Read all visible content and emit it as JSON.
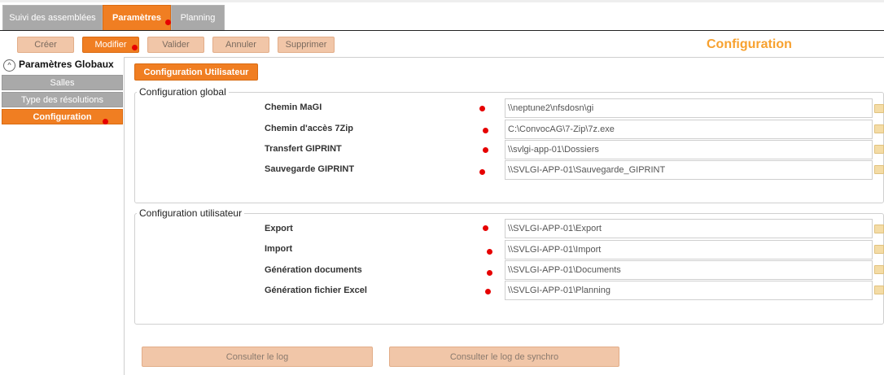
{
  "tabs": [
    {
      "label": "Suivi des assemblées"
    },
    {
      "label": "Paramètres"
    },
    {
      "label": "Planning"
    }
  ],
  "toolbar": {
    "create": "Créer",
    "modify": "Modifier",
    "validate": "Valider",
    "cancel": "Annuler",
    "delete": "Supprimer"
  },
  "page_title": "Configuration",
  "sidebar": {
    "group_label": "Paramètres Globaux",
    "items": [
      {
        "label": "Salles"
      },
      {
        "label": "Type des résolutions"
      },
      {
        "label": "Configuration"
      }
    ]
  },
  "config_user_button": "Configuration Utilisateur",
  "global_section": {
    "legend": "Configuration global",
    "fields": [
      {
        "label": "Chemin MaGI",
        "value": "\\\\neptune2\\nfsdosn\\gi"
      },
      {
        "label": "Chemin d'accès 7Zip",
        "value": "C:\\ConvocAG\\7-Zip\\7z.exe"
      },
      {
        "label": "Transfert GIPRINT",
        "value": "\\\\svlgi-app-01\\Dossiers"
      },
      {
        "label": "Sauvegarde GIPRINT",
        "value": "\\\\SVLGI-APP-01\\Sauvegarde_GIPRINT"
      }
    ]
  },
  "user_section": {
    "legend": "Configuration utilisateur",
    "fields": [
      {
        "label": "Export",
        "value": "\\\\SVLGI-APP-01\\Export"
      },
      {
        "label": "Import",
        "value": "\\\\SVLGI-APP-01\\Import"
      },
      {
        "label": "Génération documents",
        "value": "\\\\SVLGI-APP-01\\Documents"
      },
      {
        "label": "Génération fichier Excel",
        "value": "\\\\SVLGI-APP-01\\Planning"
      }
    ]
  },
  "bottom_buttons": {
    "log": "Consulter le log",
    "sync_log": "Consulter le log de synchro"
  },
  "colors": {
    "accent": "#f07e22",
    "title": "#f7a12f",
    "inactive": "#a9a9a9",
    "marker": "#e60000"
  }
}
